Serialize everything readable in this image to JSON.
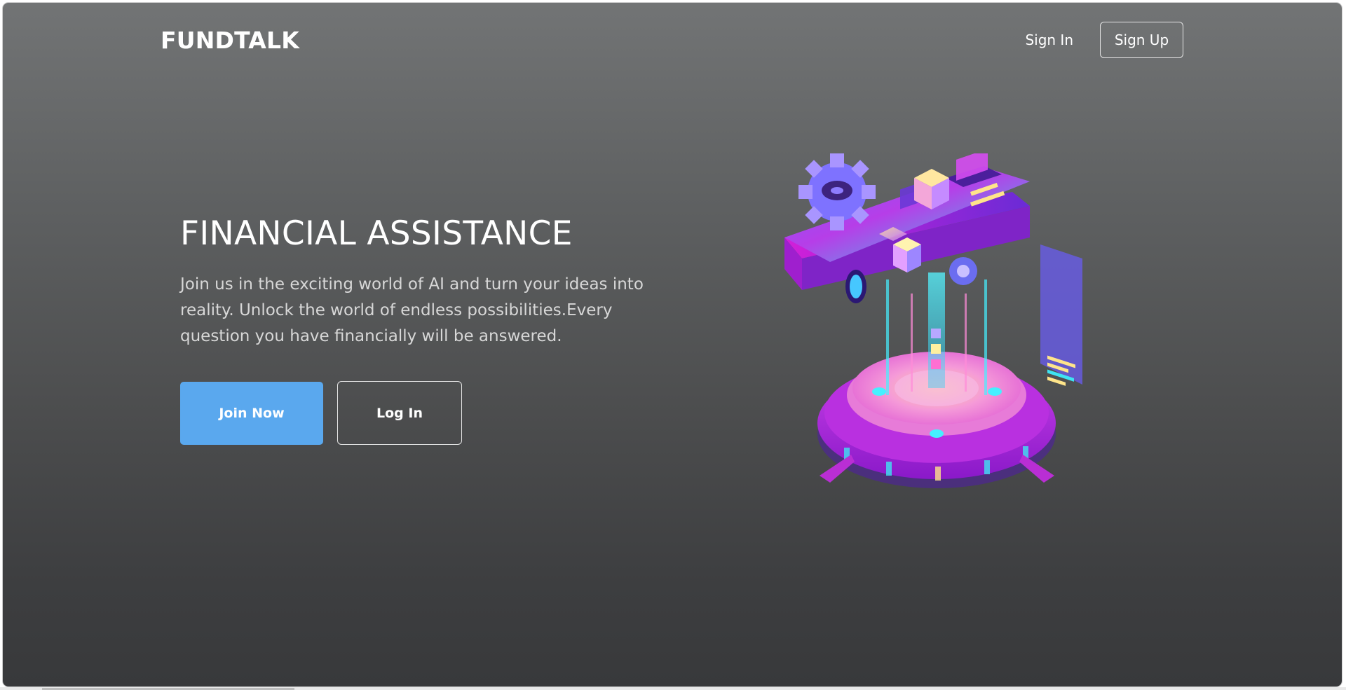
{
  "header": {
    "logo": "FUNDTALK",
    "sign_in": "Sign In",
    "sign_up": "Sign Up"
  },
  "hero": {
    "title": "FINANCIAL ASSISTANCE",
    "description": "Join us in the exciting world of AI and turn your ideas into reality. Unlock the world of endless possibilities.Every question you have financially will be answered.",
    "join_button": "Join Now",
    "login_button": "Log In"
  },
  "illustration": {
    "name": "isometric-ai-phone-illustration"
  },
  "colors": {
    "primary_button": "#5aa8ee",
    "background_top": "#727475",
    "background_bottom": "#38393b",
    "accent_magenta": "#c21bd8",
    "accent_cyan": "#3ee3f2"
  }
}
